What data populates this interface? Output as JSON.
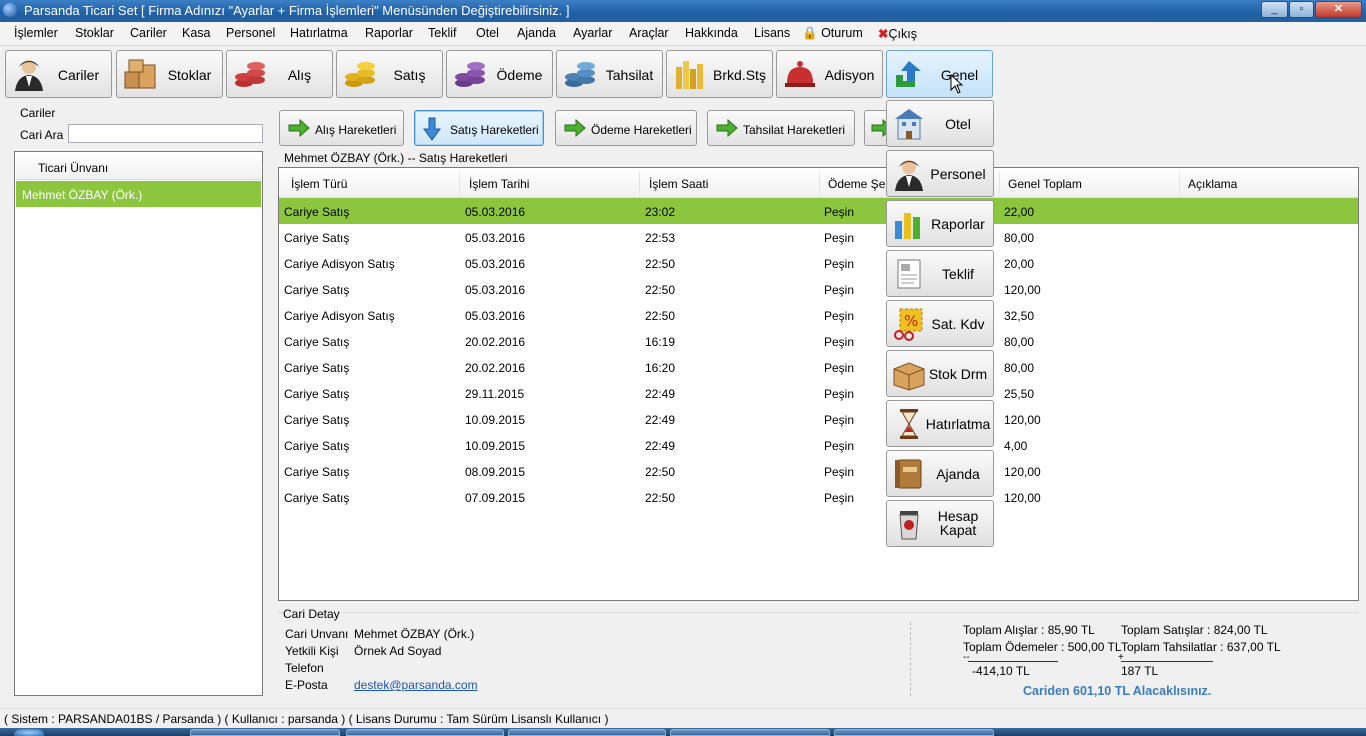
{
  "window": {
    "title": "Parsanda Ticari Set  [ Firma Adınızı \"Ayarlar + Firma İşlemleri\" Menüsünden Değiştirebilirsiniz. ]"
  },
  "menu": [
    "İşlemler",
    "Stoklar",
    "Cariler",
    "Kasa",
    "Personel",
    "Hatırlatma",
    "Raporlar",
    "Teklif",
    "Otel",
    "Ajanda",
    "Ayarlar",
    "Araçlar",
    "Hakkında",
    "Lisans",
    "Oturum",
    "Çıkış"
  ],
  "toolbar": [
    "Cariler",
    "Stoklar",
    "Alış",
    "Satış",
    "Ödeme",
    "Tahsilat",
    "Brkd.Stş",
    "Adisyon",
    "Genel"
  ],
  "left": {
    "group_label": "Cariler",
    "search_label": "Cari Ara",
    "search_value": "",
    "list_header": "Ticari Ünvanı",
    "selected": "Mehmet ÖZBAY (Örk.)"
  },
  "hareket_buttons": [
    "Alış Hareketleri",
    "Satış Hareketleri",
    "Ödeme Hareketleri",
    "Tahsilat Hareketleri"
  ],
  "grid": {
    "caption": "Mehmet ÖZBAY (Örk.) -- Satış Hareketleri",
    "columns": [
      "İşlem Türü",
      "İşlem Tarihi",
      "İşlem Saati",
      "Ödeme Şekli",
      "Genel Toplam",
      "Açıklama"
    ],
    "rows": [
      [
        "Cariye Satış",
        "05.03.2016",
        "23:02",
        "Peşin",
        "22,00",
        ""
      ],
      [
        "Cariye Satış",
        "05.03.2016",
        "22:53",
        "Peşin",
        "80,00",
        ""
      ],
      [
        "Cariye Adisyon Satış",
        "05.03.2016",
        "22:50",
        "Peşin",
        "20,00",
        ""
      ],
      [
        "Cariye Satış",
        "05.03.2016",
        "22:50",
        "Peşin",
        "120,00",
        ""
      ],
      [
        "Cariye Adisyon Satış",
        "05.03.2016",
        "22:50",
        "Peşin",
        "32,50",
        ""
      ],
      [
        "Cariye Satış",
        "20.02.2016",
        "16:19",
        "Peşin",
        "80,00",
        ""
      ],
      [
        "Cariye Satış",
        "20.02.2016",
        "16:20",
        "Peşin",
        "80,00",
        ""
      ],
      [
        "Cariye Satış",
        "29.11.2015",
        "22:49",
        "Peşin",
        "25,50",
        ""
      ],
      [
        "Cariye Satış",
        "10.09.2015",
        "22:49",
        "Peşin",
        "120,00",
        ""
      ],
      [
        "Cariye Satış",
        "10.09.2015",
        "22:49",
        "Peşin",
        "4,00",
        ""
      ],
      [
        "Cariye Satış",
        "08.09.2015",
        "22:50",
        "Peşin",
        "120,00",
        ""
      ],
      [
        "Cariye Satış",
        "07.09.2015",
        "22:50",
        "Peşin",
        "120,00",
        ""
      ]
    ]
  },
  "dropdown": [
    "Otel",
    "Personel",
    "Raporlar",
    "Teklif",
    "Sat. Kdv",
    "Stok Drm",
    "Hatırlatma",
    "Ajanda",
    "Hesap Kapat"
  ],
  "detail": {
    "group_label": "Cari Detay",
    "labels": [
      "Cari Unvanı",
      "Yetkili Kişi",
      "Telefon",
      "E-Posta"
    ],
    "values": [
      "Mehmet ÖZBAY (Örk.)",
      "Örnek Ad Soyad",
      "",
      "destek@parsanda.com"
    ],
    "totals": {
      "alis": "Toplam Alışlar :  85,90 TL",
      "odemeler": "Toplam Ödemeler :  500,00 TL",
      "minus": "--",
      "diff1": "-414,10 TL",
      "satislar": "Toplam Satışlar :  824,00 TL",
      "tahsilatlar": "Toplam Tahsilatlar :  637,00 TL",
      "plus": "+",
      "diff2": "187 TL",
      "summary": "Cariden 601,10 TL Alacaklısınız."
    }
  },
  "status": "( Sistem : PARSANDA01BS / Parsanda )  ( Kullanıcı : parsanda )  ( Lisans Durumu : Tam Sürüm Lisanslı Kullanıcı )",
  "colors": {
    "selection": "#8cc63f",
    "link": "#1a56b0",
    "summary": "#3a7cc0",
    "exit": "#d02020"
  }
}
